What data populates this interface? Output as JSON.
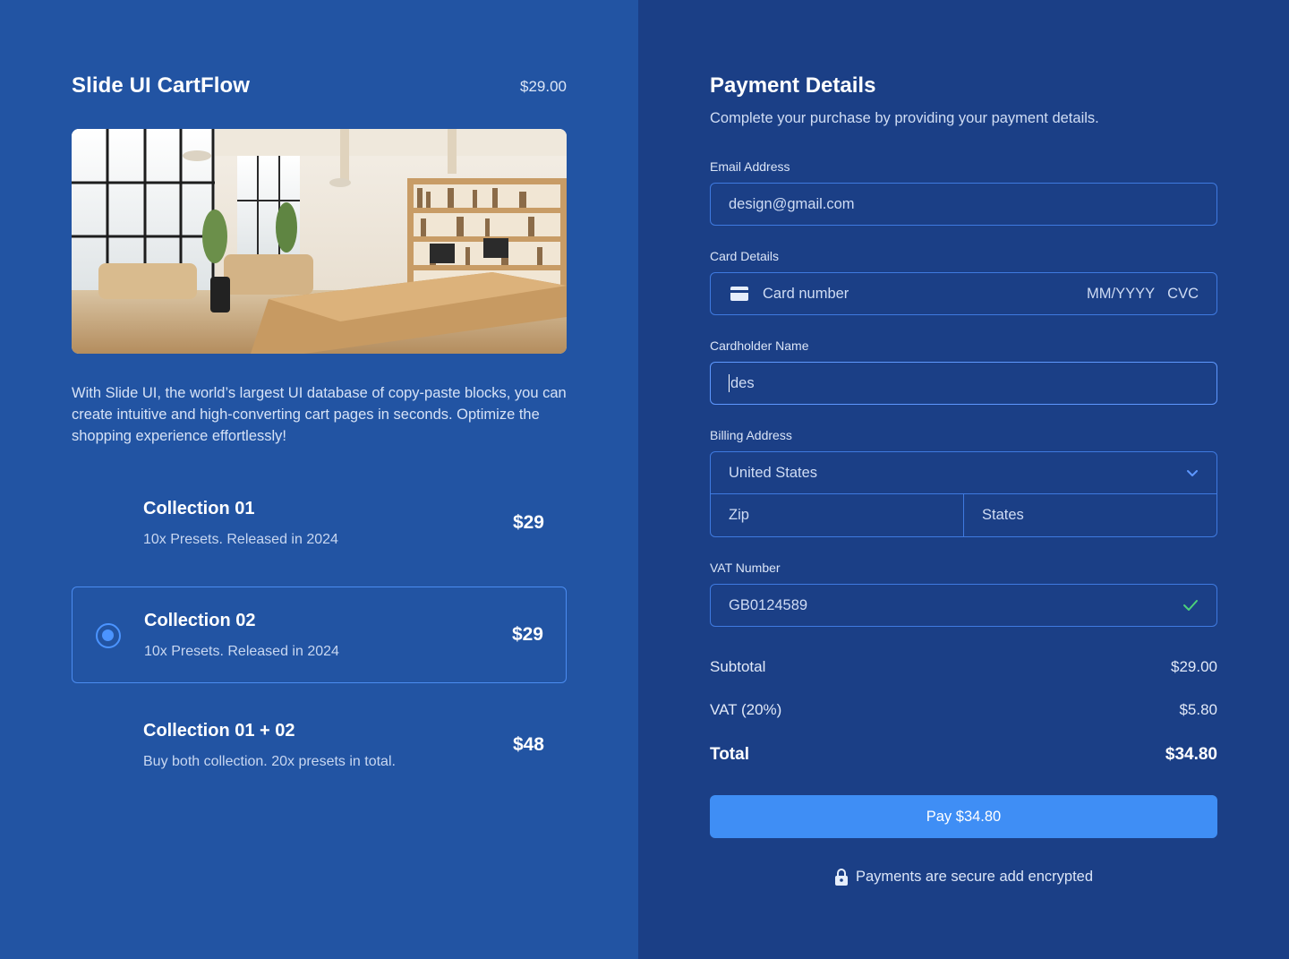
{
  "product": {
    "title": "Slide UI CartFlow",
    "price": "$29.00",
    "description": "With Slide UI, the world’s largest UI database of copy-paste blocks, you can create intuitive and high-converting cart pages in seconds. Optimize the shopping experience effortlessly!"
  },
  "options": [
    {
      "title": "Collection 01",
      "subtitle": "10x Presets. Released in 2024",
      "price": "$29",
      "selected": false
    },
    {
      "title": "Collection 02",
      "subtitle": "10x Presets. Released in 2024",
      "price": "$29",
      "selected": true
    },
    {
      "title": "Collection 01 + 02",
      "subtitle": "Buy both collection. 20x presets in total.",
      "price": "$48",
      "selected": false
    }
  ],
  "payment": {
    "title": "Payment Details",
    "subtitle": "Complete your purchase by providing your payment details.",
    "email": {
      "label": "Email Address",
      "value": "design@gmail.com"
    },
    "card": {
      "label": "Card Details",
      "number_placeholder": "Card number",
      "expiry_placeholder": "MM/YYYY",
      "cvc_placeholder": "CVC"
    },
    "cardholder": {
      "label": "Cardholder Name",
      "value": "des"
    },
    "billing": {
      "label": "Billing Address",
      "country": "United States",
      "zip_placeholder": "Zip",
      "state_placeholder": "States"
    },
    "vat": {
      "label": "VAT Number",
      "value": "GB0124589"
    }
  },
  "summary": {
    "subtotal_label": "Subtotal",
    "subtotal_value": "$29.00",
    "vat_label": "VAT (20%)",
    "vat_value": "$5.80",
    "total_label": "Total",
    "total_value": "$34.80"
  },
  "pay_button_label": "Pay $34.80",
  "secure_note": "Payments are secure add encrypted",
  "icons": {
    "card": "credit-card-icon",
    "dropdown": "chevron-down-icon",
    "valid": "check-icon",
    "secure": "lock-icon",
    "radio": "radio-selected-icon"
  },
  "colors": {
    "left_bg": "#2254a3",
    "right_bg": "#1b3f86",
    "accent": "#3f8ef5",
    "border": "#3f7ae0",
    "success": "#4cd17a"
  }
}
